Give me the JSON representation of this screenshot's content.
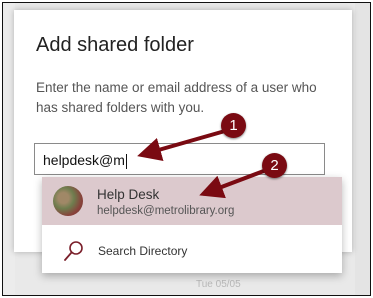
{
  "background": {
    "date_fragment": "Tue 05/05"
  },
  "dialog": {
    "title": "Add shared folder",
    "instruction": "Enter the name or email address of a user who has shared folders with you.",
    "input_value": "helpdesk@m"
  },
  "suggestions": [
    {
      "name": "Help Desk",
      "email": "helpdesk@metrolibrary.org"
    }
  ],
  "search_directory_label": "Search Directory",
  "callouts": [
    {
      "number": "1"
    },
    {
      "number": "2"
    }
  ],
  "colors": {
    "callout": "#7a0a12",
    "suggestion_highlight": "#dcc9cd"
  }
}
